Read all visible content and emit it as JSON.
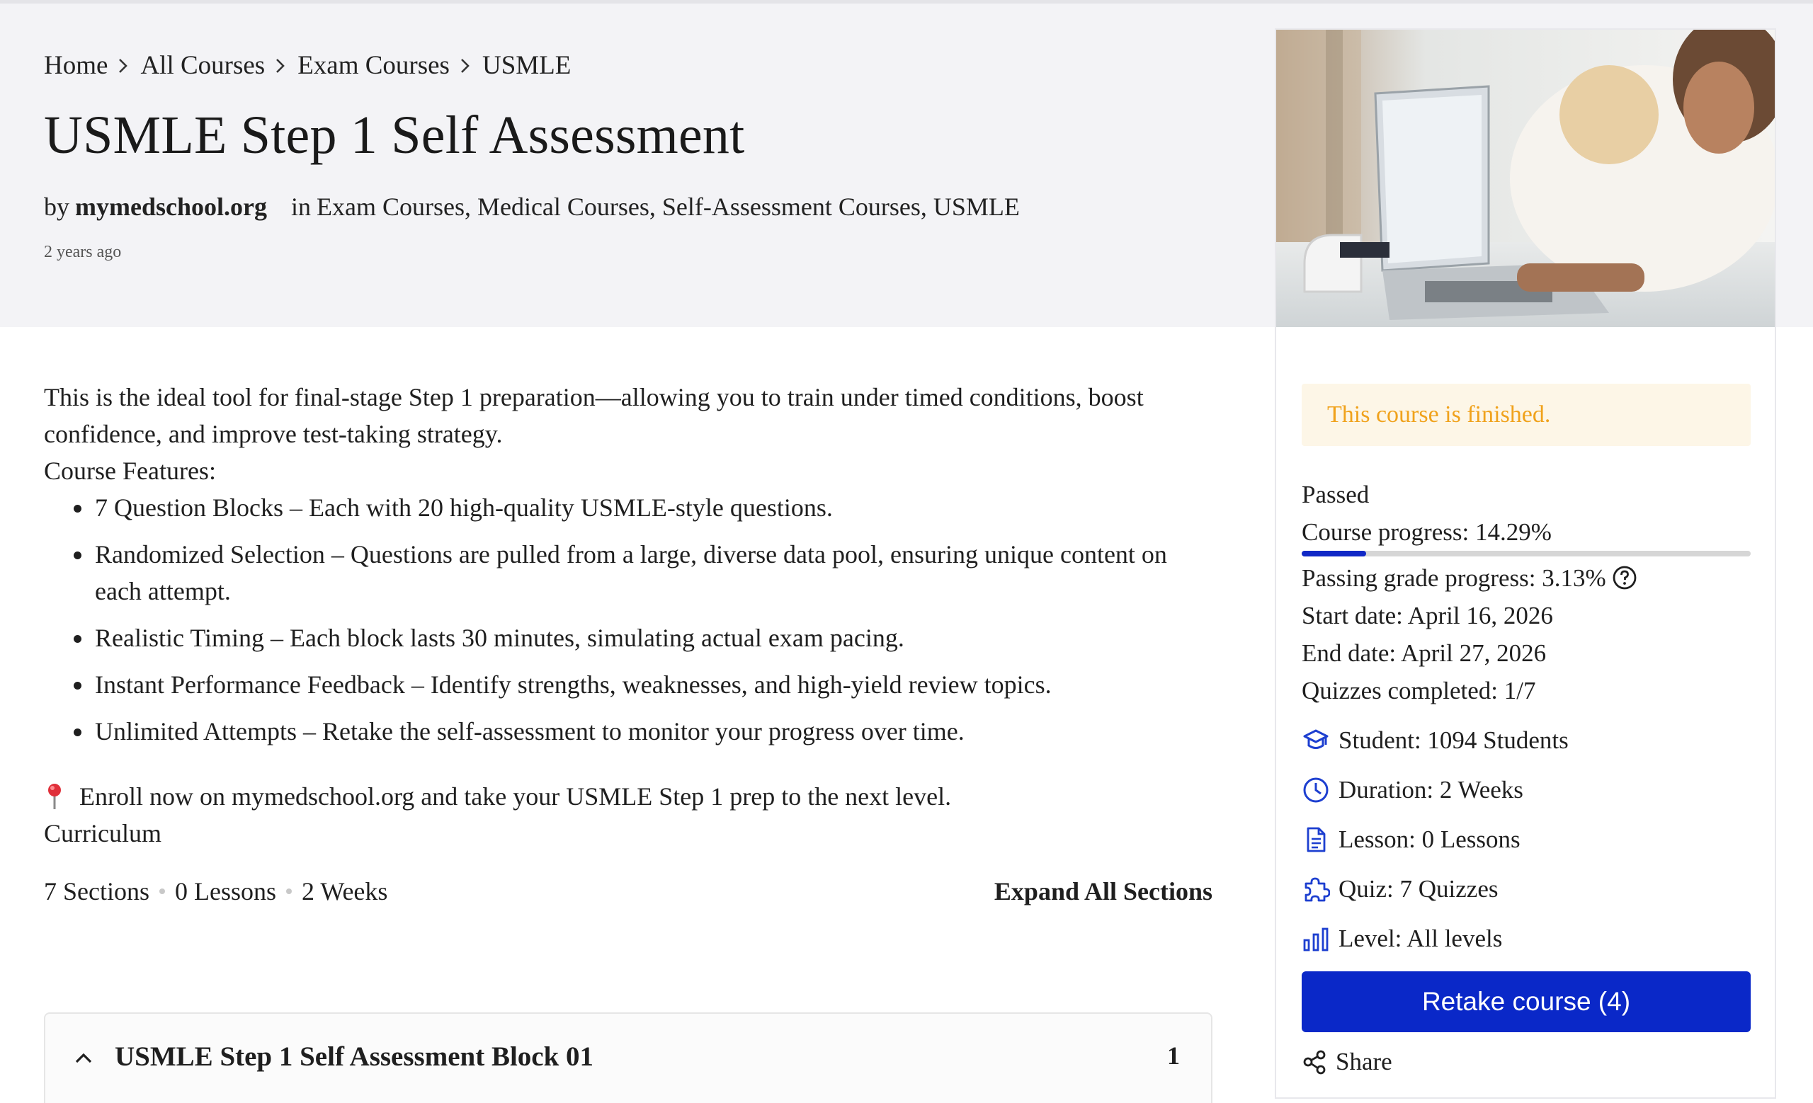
{
  "breadcrumb": [
    {
      "label": "Home"
    },
    {
      "label": "All Courses"
    },
    {
      "label": "Exam Courses"
    },
    {
      "label": "USMLE"
    }
  ],
  "course": {
    "title": "USMLE Step 1 Self Assessment",
    "by_prefix": "by",
    "author": "mymedschool.org",
    "in_prefix": "in",
    "categories": "Exam Courses, Medical Courses, Self-Assessment Courses, USMLE",
    "posted": "2 years ago"
  },
  "description": {
    "intro": "This is the ideal tool for final-stage Step 1 preparation—allowing you to train under timed conditions, boost confidence, and improve test-taking strategy.",
    "features_label": "Course Features:",
    "features": [
      "7 Question Blocks – Each with 20 high-quality USMLE-style questions.",
      "Randomized Selection – Questions are pulled from a large, diverse data pool, ensuring unique content on each attempt.",
      "Realistic Timing – Each block lasts 30 minutes, simulating actual exam pacing.",
      "Instant Performance Feedback – Identify strengths, weaknesses, and high-yield review topics.",
      "Unlimited Attempts – Retake the self-assessment to monitor your progress over time."
    ],
    "enroll": "Enroll now on mymedschool.org and take your USMLE Step 1 prep to the next level."
  },
  "curriculum": {
    "label": "Curriculum",
    "sections": "7 Sections",
    "lessons": "0 Lessons",
    "duration": "2 Weeks",
    "expand_all": "Expand All Sections",
    "first_section": {
      "title": "USMLE Step 1 Self Assessment Block 01",
      "count": "1"
    }
  },
  "sidebar": {
    "notice": "This course is finished.",
    "status": "Passed",
    "course_progress": "Course progress: 14.29%",
    "course_progress_value": 14.29,
    "passing_grade": "Passing grade progress: 3.13%",
    "start_date": "Start date: April 16, 2026",
    "end_date": "End date: April 27, 2026",
    "quizzes_completed": "Quizzes completed: 1/7",
    "student": "Student: 1094 Students",
    "duration": "Duration: 2 Weeks",
    "lesson": "Lesson: 0 Lessons",
    "quiz": "Quiz: 7 Quizzes",
    "level": "Level: All levels",
    "retake_label": "Retake course (4)",
    "share_label": "Share"
  },
  "colors": {
    "accent": "#0a28c8",
    "notice_text": "#f0a21c",
    "notice_bg": "#fdf6e7"
  },
  "icons": [
    "chevron-right-icon",
    "pin-icon",
    "chevron-up-icon",
    "help-circle-icon",
    "graduation-cap-icon",
    "clock-icon",
    "document-icon",
    "puzzle-icon",
    "bar-chart-icon",
    "share-icon"
  ]
}
